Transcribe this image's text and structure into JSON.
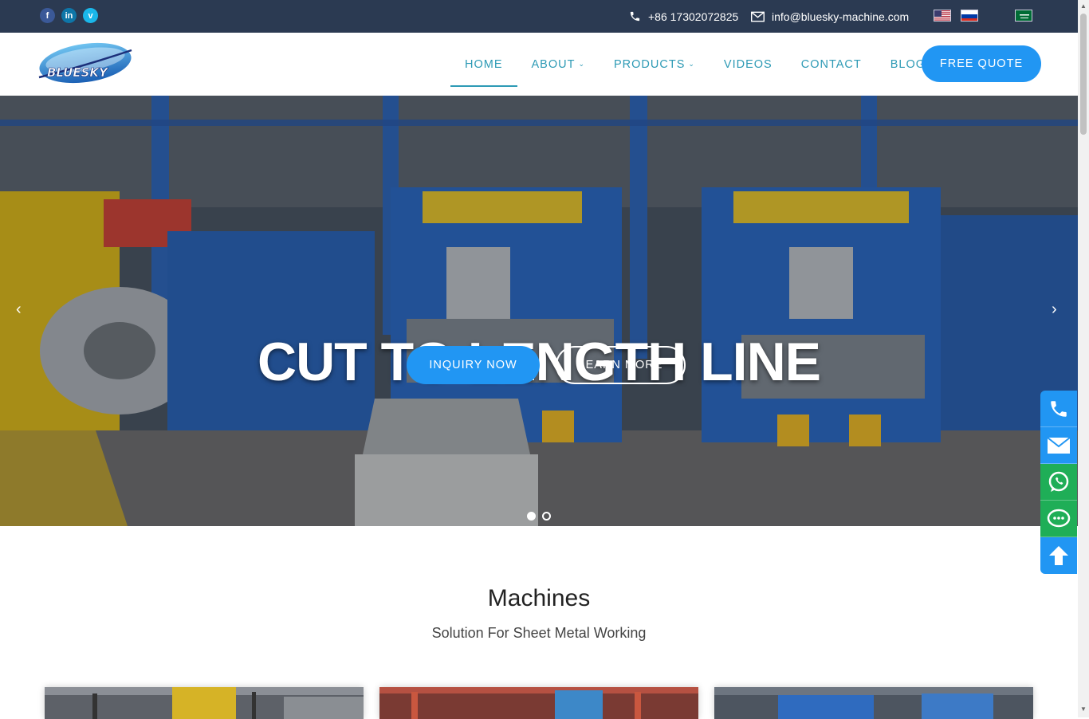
{
  "topbar": {
    "social": [
      "f",
      "in",
      "v"
    ],
    "phone": "+86 17302072825",
    "email": "info@bluesky-machine.com",
    "languages": [
      "English",
      "Russian",
      "Arabic"
    ]
  },
  "header": {
    "logo_text": "BLUESKY",
    "nav": [
      {
        "label": "HOME"
      },
      {
        "label": "ABOUT"
      },
      {
        "label": "PRODUCTS"
      },
      {
        "label": "VIDEOS"
      },
      {
        "label": "CONTACT"
      },
      {
        "label": "BLOG"
      }
    ],
    "quote_label": "FREE QUOTE"
  },
  "hero": {
    "title": "CUT TO LENGTH LINE",
    "inquiry_label": "INQUIRY NOW",
    "learn_label": "LEARN MORE",
    "prev_arrow": "‹",
    "next_arrow": "›",
    "slides_total": 2,
    "current_slide": 1
  },
  "machines": {
    "title": "Machines",
    "subtitle": "Solution For Sheet Metal Working"
  },
  "colors": {
    "topbar": "#2b3a52",
    "accent": "#2196f3",
    "nav": "#2d9ab5",
    "whatsapp": "#1fae57"
  }
}
